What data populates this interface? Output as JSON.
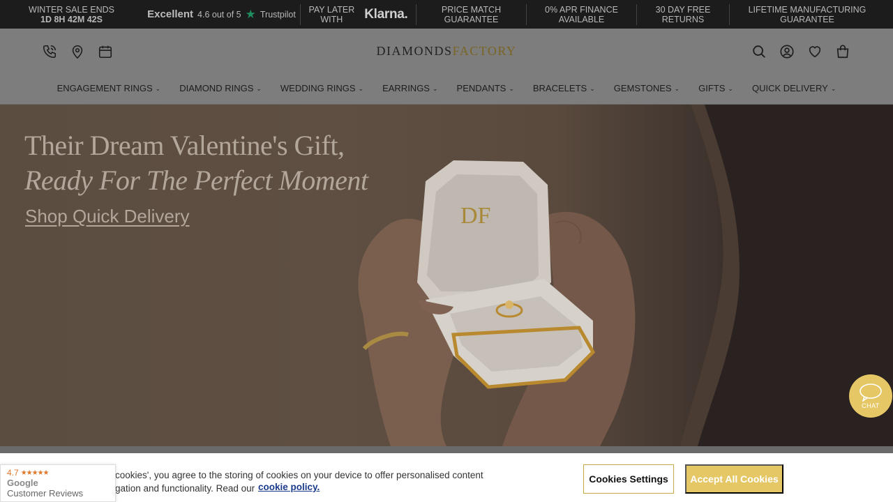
{
  "topbar": {
    "sale_line1": "WINTER SALE ENDS",
    "sale_line2": "1D 8H 42M 42S",
    "trustpilot_excellent": "Excellent",
    "trustpilot_rating": "4.6 out of 5",
    "trustpilot_brand": "Trustpilot",
    "paylater_line1": "PAY LATER",
    "paylater_line2": "WITH",
    "klarna": "Klarna.",
    "price_match_line1": "PRICE MATCH",
    "price_match_line2": "GUARANTEE",
    "finance_line1": "0% APR FINANCE",
    "finance_line2": "AVAILABLE",
    "returns_line1": "30 DAY FREE",
    "returns_line2": "RETURNS",
    "lifetime_line1": "LIFETIME MANUFACTURING",
    "lifetime_line2": "GUARANTEE"
  },
  "header": {
    "logo_part1": "DIAMONDS",
    "logo_part2": "FACTORY",
    "left_icons": [
      "phone-icon",
      "location-icon",
      "calendar-icon"
    ],
    "right_icons": [
      "search-icon",
      "account-icon",
      "wishlist-icon",
      "bag-icon"
    ]
  },
  "nav": {
    "items": [
      {
        "label": "ENGAGEMENT RINGS"
      },
      {
        "label": "DIAMOND RINGS"
      },
      {
        "label": "WEDDING RINGS"
      },
      {
        "label": "EARRINGS"
      },
      {
        "label": "PENDANTS"
      },
      {
        "label": "BRACELETS"
      },
      {
        "label": "GEMSTONES"
      },
      {
        "label": "GIFTS"
      },
      {
        "label": "QUICK DELIVERY"
      }
    ]
  },
  "hero": {
    "title_line1": "Their Dream Valentine's Gift,",
    "title_line2": "Ready For The Perfect Moment",
    "cta": "Shop Quick Delivery"
  },
  "cookie": {
    "text_line1": "cookies', you agree to the storing of cookies on your device to offer personalised content",
    "text_line2": "gation and functionality. Read our",
    "link": "cookie policy.",
    "settings_button": "Cookies Settings",
    "accept_button": "Accept All Cookies"
  },
  "google_reviews": {
    "rating": "4.7",
    "stars": "★★★★★",
    "line1": "Google",
    "line2": "Customer Reviews"
  },
  "chat": {
    "label": "CHAT"
  },
  "colors": {
    "gold": "#e5c766",
    "topbar_bg": "#1c1c1c",
    "link_blue": "#1a3a8a"
  }
}
